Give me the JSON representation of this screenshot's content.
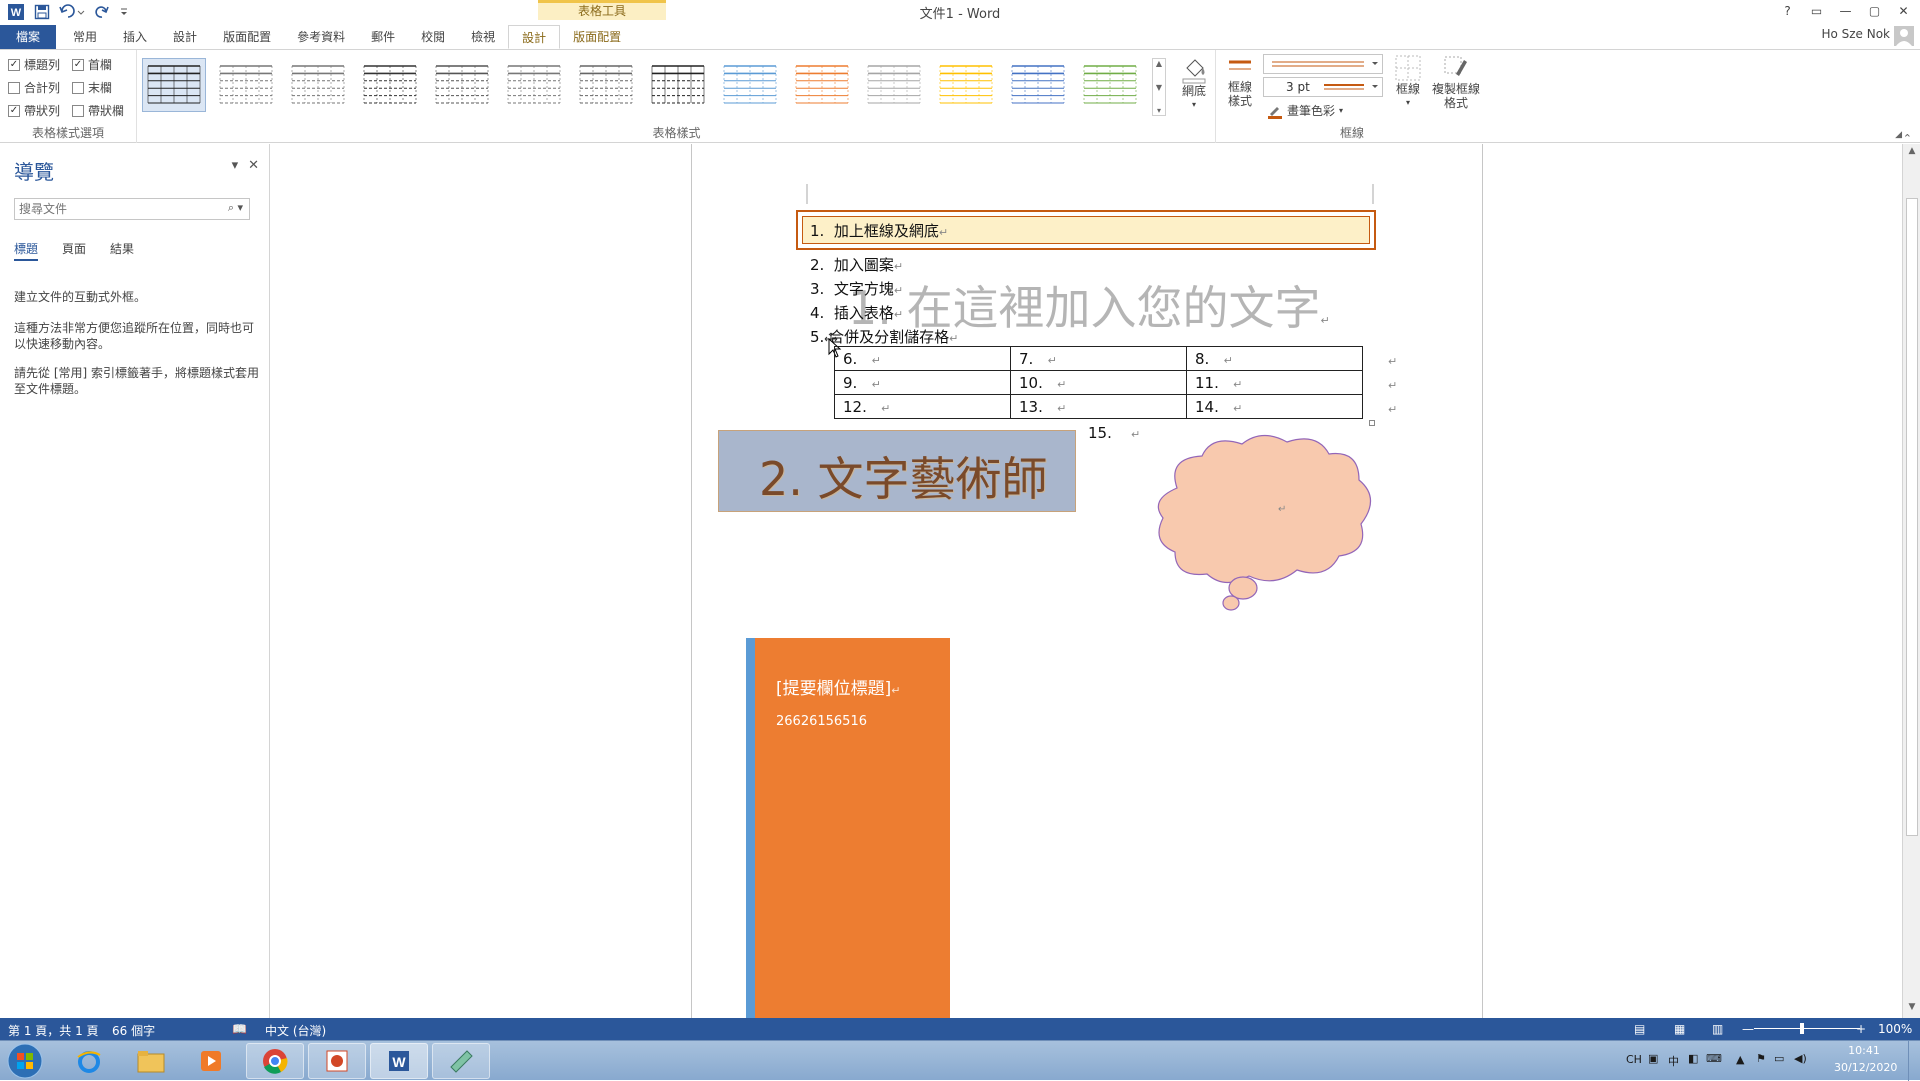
{
  "window": {
    "title": "文件1 - Word",
    "context_tab_group": "表格工具",
    "controls": [
      "?",
      "▭",
      "—",
      "▢",
      "✕"
    ]
  },
  "tabs": {
    "file": "檔案",
    "items": [
      "常用",
      "插入",
      "設計",
      "版面配置",
      "參考資料",
      "郵件",
      "校閱",
      "檢視",
      "設計",
      "版面配置"
    ],
    "active_index": 8,
    "user": "Ho Sze Nok"
  },
  "ribbon": {
    "group_style_options": {
      "label": "表格樣式選項",
      "options": [
        {
          "label": "標題列",
          "checked": true
        },
        {
          "label": "首欄",
          "checked": true
        },
        {
          "label": "合計列",
          "checked": false
        },
        {
          "label": "末欄",
          "checked": false
        },
        {
          "label": "帶狀列",
          "checked": true
        },
        {
          "label": "帶狀欄",
          "checked": false
        }
      ]
    },
    "group_table_styles": {
      "label": "表格樣式",
      "swatch_colors": [
        "#222222",
        "#777777",
        "#777777",
        "#333333",
        "#555555",
        "#777777",
        "#666666",
        "#222222",
        "#5b9bd5",
        "#ed7d31",
        "#a5a5a5",
        "#ffc000",
        "#4472c4",
        "#70ad47"
      ],
      "shading": "網底"
    },
    "group_borders": {
      "label": "框線",
      "border_styles": "框線樣式",
      "pen_weight": "3 pt",
      "pen_color": "畫筆色彩",
      "borders": "框線",
      "border_painter": "複製框線格式",
      "accent_color": "#c55a11"
    }
  },
  "nav": {
    "title": "導覽",
    "search_placeholder": "搜尋文件",
    "tabs": [
      "標題",
      "頁面",
      "結果"
    ],
    "text1": "建立文件的互動式外框。",
    "text2": "這種方法非常方便您追蹤所在位置，同時也可以快速移動內容。",
    "text3": "請先從 [常用] 索引標籤著手，將標題樣式套用至文件標題。"
  },
  "document": {
    "list": [
      "加上框線及網底",
      "加入圖案",
      "文字方塊",
      "插入表格",
      "合併及分割儲存格"
    ],
    "watermark_heading": "在這裡加入您的文字",
    "table_rows": [
      [
        "6.",
        "7.",
        "8."
      ],
      [
        "9.",
        "10.",
        "11."
      ],
      [
        "12.",
        "13.",
        "14."
      ]
    ],
    "item15": "15.",
    "wordart": "2.  文字藝術師",
    "sidebar_title": "[提要欄位標題]",
    "sidebar_number": "26626156516",
    "colors": {
      "highlight_fill": "#fdf0c8",
      "highlight_border": "#c55a11",
      "wordart_bg": "#a9b6cc",
      "cloud_fill": "#f8c9ae",
      "cloud_border": "#9366b8",
      "sidebar_orange": "#ed7d31",
      "sidebar_blue": "#5b9bd5"
    }
  },
  "status": {
    "page": "第 1 頁，共 1 頁",
    "words": "66 個字",
    "language": "中文 (台灣)",
    "zoom": "100%"
  },
  "tray": {
    "lang": "CH",
    "ime": "中",
    "time": "10:41",
    "date": "30/12/2020"
  }
}
